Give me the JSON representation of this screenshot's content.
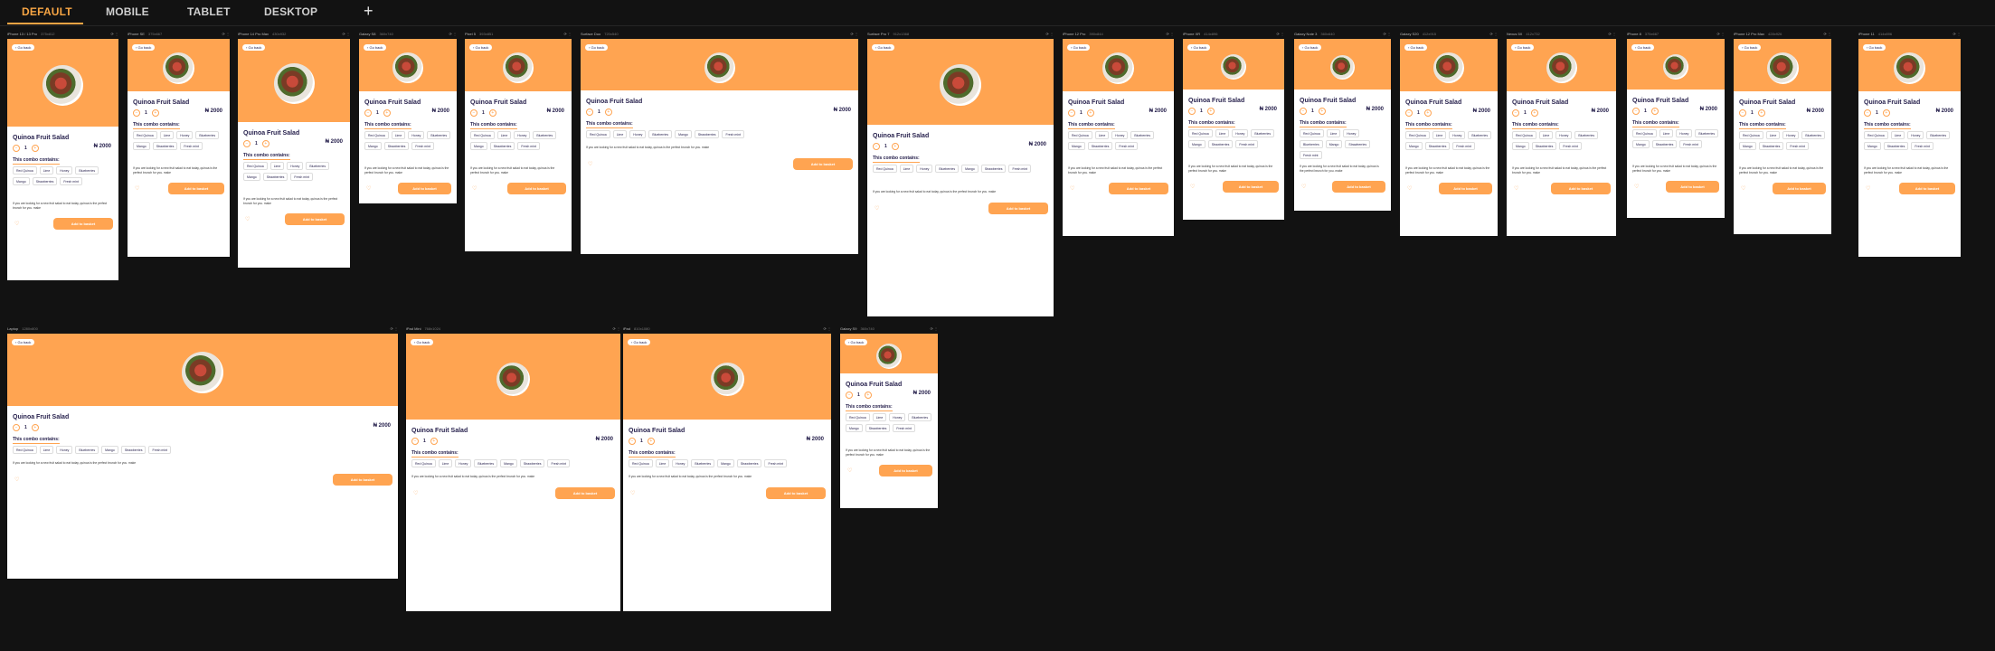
{
  "tabs": [
    "DEFAULT",
    "MOBILE",
    "TABLET",
    "DESKTOP"
  ],
  "active_tab": 0,
  "add_tab_label": "+",
  "product": {
    "go_back": "Go back",
    "title": "Quinoa Fruit Salad",
    "quantity": "1",
    "price": "₦ 2000",
    "combo_heading": "This combo contains:",
    "ingredients": [
      "Red Quinoa",
      "Lime",
      "Honey",
      "Blueberries",
      "Mango",
      "Strawberries",
      "Fresh mint"
    ],
    "description": "If you are looking for a new fruit salad to eat today, quinoa is the perfect brunch for you. make",
    "cta": "Add to basket",
    "hero_color": "#FFA451",
    "text_color": "#27214D"
  },
  "frames": [
    {
      "label": "iPhone 13 / 13 Pro",
      "dims": "375x812"
    },
    {
      "label": "iPhone SE",
      "dims": "375x667"
    },
    {
      "label": "iPhone 14 Pro Max",
      "dims": "430x932"
    },
    {
      "label": "Galaxy S8",
      "dims": "360x740"
    },
    {
      "label": "Pixel 5",
      "dims": "393x851"
    },
    {
      "label": "Surface Duo",
      "dims": "720x540"
    },
    {
      "label": "Surface Pro 7",
      "dims": "912x1368"
    },
    {
      "label": "iPhone 12 Pro",
      "dims": "390x844"
    },
    {
      "label": "iPhone XR",
      "dims": "414x896"
    },
    {
      "label": "Galaxy Note 3",
      "dims": "360x640"
    },
    {
      "label": "Galaxy S20",
      "dims": "412x915"
    },
    {
      "label": "Nexus 5X",
      "dims": "412x732"
    },
    {
      "label": "iPhone 8",
      "dims": "375x667"
    },
    {
      "label": "iPhone 12 Pro Max",
      "dims": "428x926"
    },
    {
      "label": "iPhone 11",
      "dims": "414x896"
    },
    {
      "label": "Laptop",
      "dims": "1280x800"
    },
    {
      "label": "iPad Mini",
      "dims": "768x1024"
    },
    {
      "label": "iPad",
      "dims": "810x1080"
    },
    {
      "label": "Galaxy S9",
      "dims": "360x740"
    }
  ]
}
